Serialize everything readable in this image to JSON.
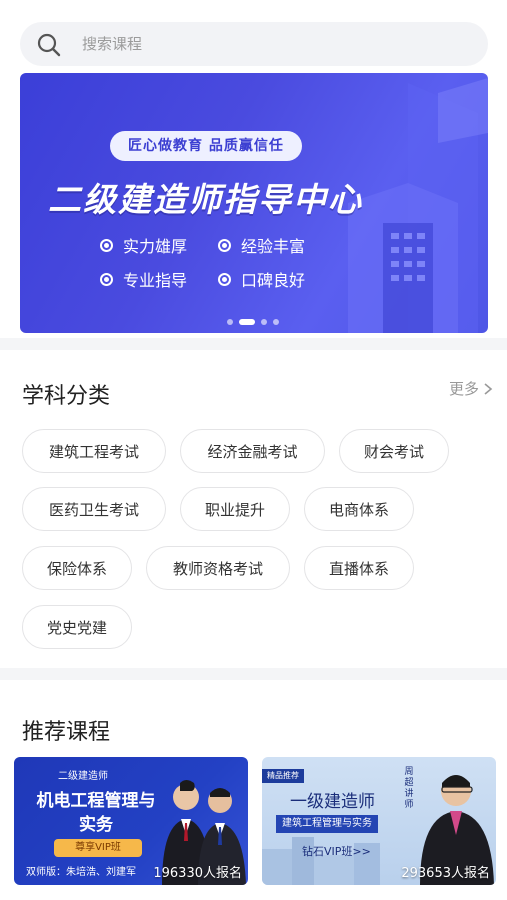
{
  "search": {
    "placeholder": "搜索课程"
  },
  "banner": {
    "slogan": "匠心做教育  品质赢信任",
    "title": "二级建造师指导中心",
    "features": [
      "实力雄厚",
      "经验丰富",
      "专业指导",
      "口碑良好"
    ],
    "pager": {
      "count": 4,
      "active_index": 1
    }
  },
  "subjects": {
    "title": "学科分类",
    "more_label": "更多",
    "chips": [
      "建筑工程考试",
      "经济金融考试",
      "财会考试",
      "医药卫生考试",
      "职业提升",
      "电商体系",
      "保险体系",
      "教师资格考试",
      "直播体系",
      "党史党建"
    ]
  },
  "recommend": {
    "title": "推荐课程",
    "courses": [
      {
        "tag": "二级建造师",
        "title": "机电工程管理与实务",
        "button": "尊享VIP班",
        "teachers": "双师版：朱培浩、刘建军",
        "enroll": "196330人报名"
      },
      {
        "badge": "精品推荐",
        "title": "一级建造师",
        "subtitle": "建筑工程管理与实务",
        "diamond": "钻石VIP班>>",
        "lecturer": "周超讲师",
        "enroll": "293653人报名"
      }
    ]
  },
  "colors": {
    "accent": "#4a4bdf",
    "chip_border": "#e4e4e6",
    "divider": "#f4f5f7"
  }
}
